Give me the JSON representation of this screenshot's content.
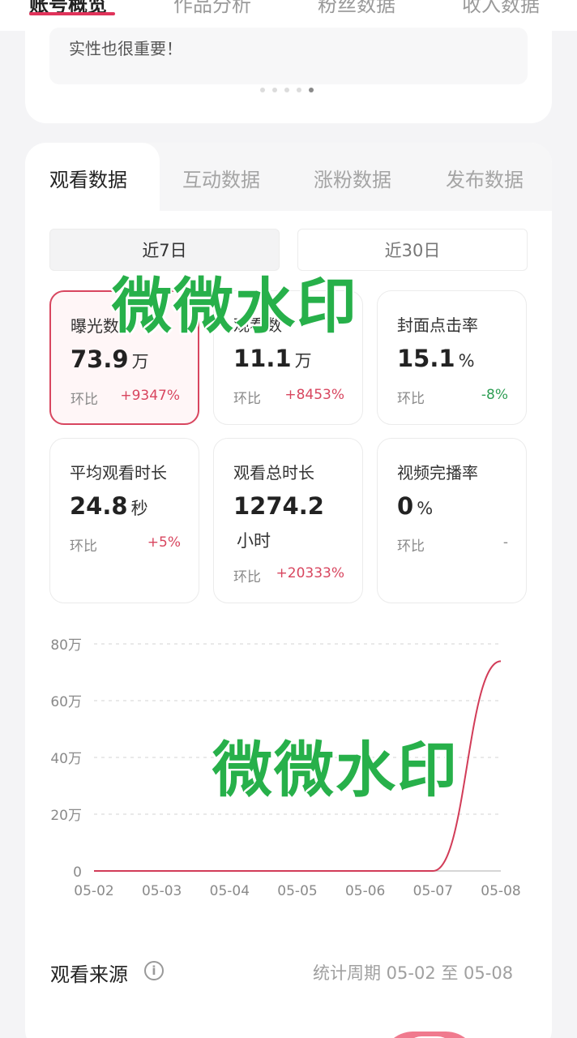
{
  "top_tabs": [
    {
      "label": "账号概览",
      "active": true
    },
    {
      "label": "作品分析",
      "active": false
    },
    {
      "label": "粉丝数据",
      "active": false
    },
    {
      "label": "收入数据",
      "active": false
    }
  ],
  "tip": {
    "text": "实性也很重要！",
    "dots": 5,
    "active_dot": 4
  },
  "sub_tabs": [
    {
      "label": "观看数据",
      "active": true
    },
    {
      "label": "互动数据",
      "active": false
    },
    {
      "label": "涨粉数据",
      "active": false
    },
    {
      "label": "发布数据",
      "active": false
    }
  ],
  "periods": {
    "active": "近7日",
    "inactive": "近30日"
  },
  "metrics": [
    {
      "label": "曝光数",
      "value": "73.9",
      "unit": "万",
      "cmp_label": "环比",
      "cmp": "+9347%",
      "trend": "up",
      "selected": true
    },
    {
      "label": "观看数",
      "value": "11.1",
      "unit": "万",
      "cmp_label": "环比",
      "cmp": "+8453%",
      "trend": "up",
      "selected": false
    },
    {
      "label": "封面点击率",
      "value": "15.1",
      "unit": "%",
      "cmp_label": "环比",
      "cmp": "-8%",
      "trend": "down",
      "selected": false
    },
    {
      "label": "平均观看时长",
      "value": "24.8",
      "unit": "秒",
      "cmp_label": "环比",
      "cmp": "+5%",
      "trend": "up",
      "selected": false
    },
    {
      "label": "观看总时长",
      "value": "1274.2",
      "unit": "小时",
      "cmp_label": "环比",
      "cmp": "+20333%",
      "trend": "up",
      "selected": false
    },
    {
      "label": "视频完播率",
      "value": "0",
      "unit": "%",
      "cmp_label": "环比",
      "cmp": "-",
      "trend": "neutral",
      "selected": false
    }
  ],
  "chart_data": {
    "type": "line",
    "x": [
      "05-02",
      "05-03",
      "05-04",
      "05-05",
      "05-06",
      "05-07",
      "05-08"
    ],
    "series": [
      {
        "values": [
          0,
          0,
          0,
          0,
          0,
          0,
          73.9
        ]
      }
    ],
    "y_ticks": [
      "0",
      "20万",
      "40万",
      "60万",
      "80万"
    ],
    "ylim": [
      0,
      80
    ],
    "grid": true,
    "line_color": "#d23c58"
  },
  "source": {
    "title": "观看来源",
    "period_note": "统计周期 05-02 至 05-08"
  },
  "watermark": {
    "text": "微微水印"
  }
}
